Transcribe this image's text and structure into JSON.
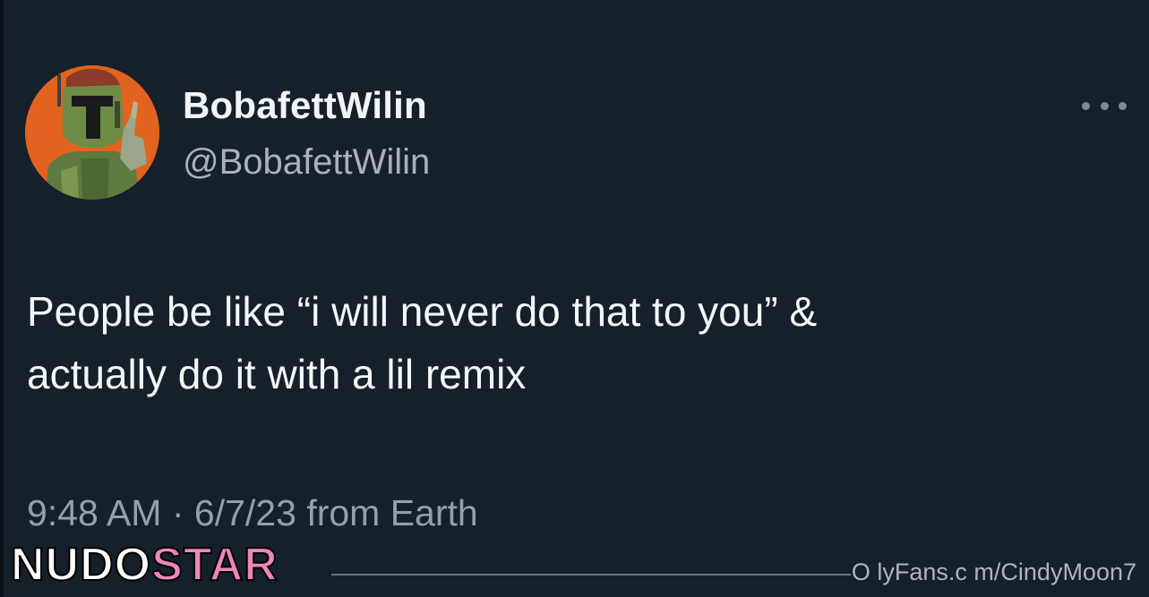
{
  "tweet": {
    "display_name": "BobafettWilin",
    "handle": "@BobafettWilin",
    "text": "People be like “i will never do that to you” &\nactually do it with a lil remix",
    "time": "9:48 AM",
    "separator": "·",
    "date": "6/7/23",
    "source": "from Earth",
    "menu_icon": "more-horizontal-icon"
  },
  "avatar": {
    "description_icon": "profile-avatar-icon",
    "background_color": "#e2631f"
  },
  "watermark": {
    "logo_part1": "NUDO",
    "logo_part2": "STAR",
    "logo_color_1": "#ffffff",
    "logo_color_2": "#ee87b8",
    "url": "O lyFans.c m/CindyMoon7"
  },
  "colors": {
    "background": "#16202a",
    "primary_text": "#f4f6f7",
    "secondary_text": "#a9b1b9"
  }
}
